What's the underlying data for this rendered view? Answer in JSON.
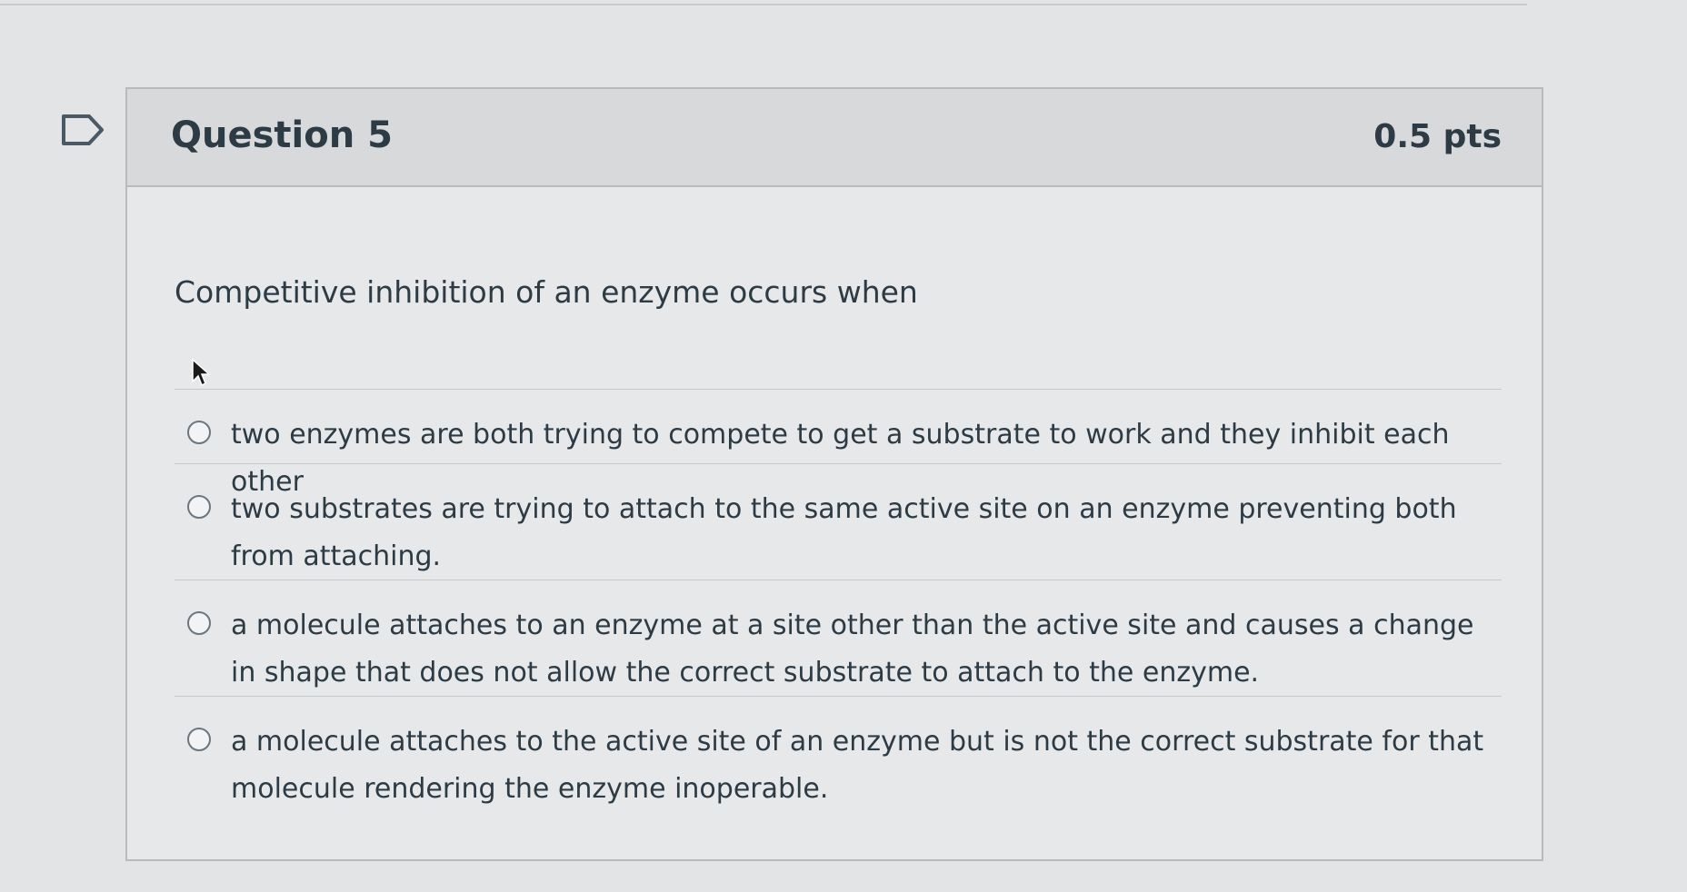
{
  "question": {
    "title": "Question 5",
    "points": "0.5 pts",
    "prompt": "Competitive inhibition of an enzyme occurs when",
    "answers": [
      {
        "label": "two enzymes are both trying to compete to get a substrate to work and they inhibit each other",
        "selected": false
      },
      {
        "label": "two substrates are trying to attach to the same active site on an enzyme preventing both from attaching.",
        "selected": false
      },
      {
        "label": "a molecule attaches to an enzyme at a site other than the active site and causes a change in shape that does not allow the correct substrate to attach to the enzyme.",
        "selected": false
      },
      {
        "label": "a molecule attaches to the active site of an enzyme but is not the correct substrate for that molecule rendering the enzyme inoperable.",
        "selected": false
      }
    ]
  },
  "icons": {
    "flag": "flag-bookmark-icon",
    "cursor": "mouse-pointer-icon"
  }
}
